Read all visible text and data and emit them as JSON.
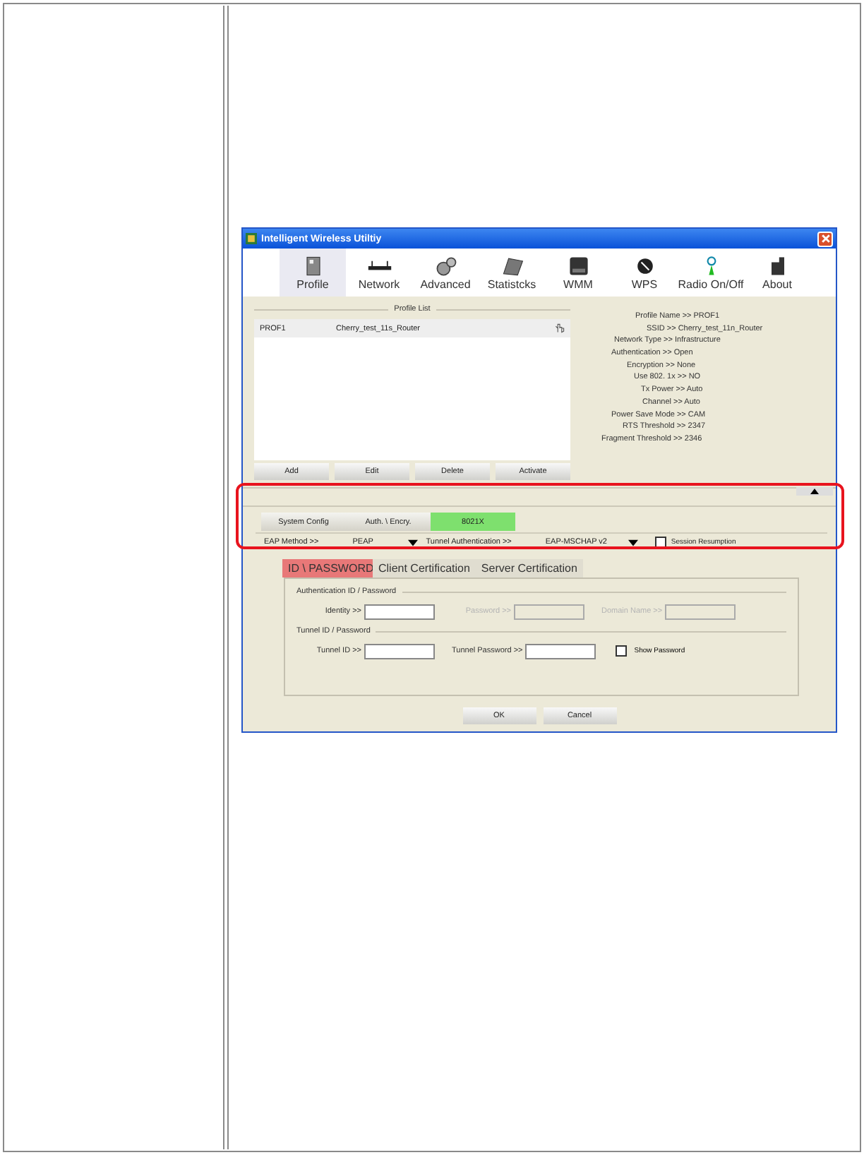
{
  "window": {
    "title": "Intelligent Wireless Utiltiy"
  },
  "toolbar": [
    {
      "label": "Profile",
      "selected": true
    },
    {
      "label": "Network",
      "selected": false
    },
    {
      "label": "Advanced",
      "selected": false
    },
    {
      "label": "Statistcks",
      "selected": false
    },
    {
      "label": "WMM",
      "selected": false
    },
    {
      "label": "WPS",
      "selected": false
    },
    {
      "label": "Radio On/Off",
      "selected": false
    },
    {
      "label": "About",
      "selected": false
    }
  ],
  "profile_list": {
    "title": "Profile List",
    "rows": [
      {
        "name": "PROF1",
        "ssid": "Cherry_test_11s_Router"
      }
    ],
    "buttons": [
      "Add",
      "Edit",
      "Delete",
      "Activate"
    ]
  },
  "profile_info": [
    "Profile Name >> PROF1",
    "SSID >> Cherry_test_11n_Router",
    "Network Type >> Infrastructure",
    "Authentication >> Open",
    "Encryption >> None",
    "Use 802. 1x >> NO",
    "Tx Power >> Auto",
    "Channel >> Auto",
    "Power Save Mode >> CAM",
    "RTS Threshold >> 2347",
    "Fragment Threshold >> 2346"
  ],
  "config_tabs": [
    {
      "label": "System Config",
      "selected": false
    },
    {
      "label": "Auth. \\ Encry.",
      "selected": false
    },
    {
      "label": "8021X",
      "selected": true
    }
  ],
  "eap": {
    "method_label": "EAP Method >>",
    "method": "PEAP",
    "tunnel_label": "Tunnel Authentication >>",
    "tunnel": "EAP-MSCHAP v2",
    "session_resumption": {
      "label": "Session Resumption",
      "checked": false
    }
  },
  "sub_tabs": [
    {
      "label": "ID \\ PASSWORD",
      "selected": true
    },
    {
      "label": "Client Certification",
      "selected": false
    },
    {
      "label": "Server Certification",
      "selected": false
    }
  ],
  "auth_group": {
    "title": "Authentication ID / Password",
    "fields": [
      {
        "label": "Identity >>",
        "disabled": false
      },
      {
        "label": "Password >>",
        "disabled": true
      },
      {
        "label": "Domain Name >>",
        "disabled": true
      }
    ]
  },
  "tunnel_group": {
    "title": "Tunnel ID / Password",
    "fields": [
      {
        "label": "Tunnel ID >>",
        "disabled": false
      },
      {
        "label": "Tunnel Password >>",
        "disabled": false
      }
    ],
    "show_password": {
      "label": "Show Password",
      "checked": false
    }
  },
  "buttons": [
    "OK",
    "Cancel"
  ]
}
